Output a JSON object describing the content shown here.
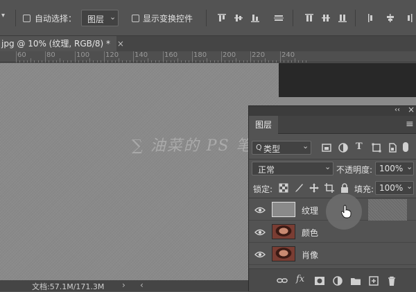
{
  "options_bar": {
    "auto_select_label": "自动选择：",
    "auto_select_target": "图层",
    "show_transform_label": "显示变换控件"
  },
  "document_tab": {
    "title": "jpg @ 10% (纹理, RGB/8) *",
    "close_glyph": "×"
  },
  "ruler": {
    "labels": [
      "60",
      "80",
      "100",
      "120",
      "140",
      "160",
      "180",
      "200",
      "220",
      "240"
    ]
  },
  "watermark": "∑ 油菜的 PS 笔记",
  "status_bar": {
    "doc_info": "文档:57.1M/171.3M"
  },
  "layers_panel": {
    "collapse_glyph": "‹‹",
    "close_glyph": "×",
    "tab_label": "图层",
    "menu_glyph": "≡",
    "filter_kind": "类型",
    "filter_prefix": "Q",
    "blend_mode": "正常",
    "opacity_label": "不透明度:",
    "opacity_value": "100%",
    "lock_label": "锁定:",
    "fill_label": "填充:",
    "fill_value": "100%",
    "layers": [
      {
        "name": "纹理",
        "visible": true,
        "thumb": "gray",
        "selected": false
      },
      {
        "name": "颜色",
        "visible": true,
        "thumb": "portrait",
        "selected": false
      },
      {
        "name": "肖像",
        "visible": true,
        "thumb": "portrait",
        "selected": false
      }
    ],
    "footer_fx": "fx"
  },
  "colors": {
    "ui_gray": "#535353",
    "canvas_gray": "#8a8a8a",
    "pasteboard": "#282828"
  }
}
